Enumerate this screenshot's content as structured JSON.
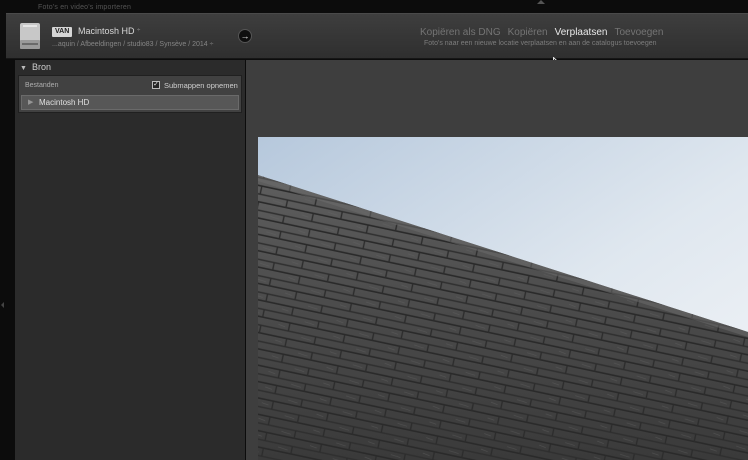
{
  "window": {
    "title": "Foto's en video's importeren"
  },
  "source": {
    "badge": "VAN",
    "name": "Macintosh HD",
    "dropdown_caret": "÷",
    "path": "...aquin / Afbeeldingen / studio83 / Synsève / 2014 ÷"
  },
  "go_button": {
    "glyph": "→"
  },
  "modes": {
    "items": [
      {
        "label": "Kopiëren als DNG",
        "active": false
      },
      {
        "label": "Kopiëren",
        "active": false
      },
      {
        "label": "Verplaatsen",
        "active": true
      },
      {
        "label": "Toevoegen",
        "active": false
      }
    ],
    "description": "Foto's naar een nieuwe locatie verplaatsen en aan de catalogus toevoegen"
  },
  "bron": {
    "title": "Bron",
    "files_label": "Bestanden",
    "subfolders": {
      "label": "Submappen opnemen",
      "checked": true,
      "check_glyph": "✓"
    },
    "volumes": [
      {
        "label": "Macintosh HD"
      }
    ]
  },
  "colors": {
    "background": "#0c0c0c",
    "panel": "#2b2b2b",
    "preview_area": "#3e3e3e",
    "active_mode": "#e8e8e8",
    "inactive_mode": "#747474"
  },
  "icons": {
    "drive": "hard-drive-icon",
    "go": "arrow-right-icon",
    "disclosure": "triangle-down-icon",
    "volume": "triangle-right-icon",
    "cursor": "mouse-pointer-icon"
  }
}
